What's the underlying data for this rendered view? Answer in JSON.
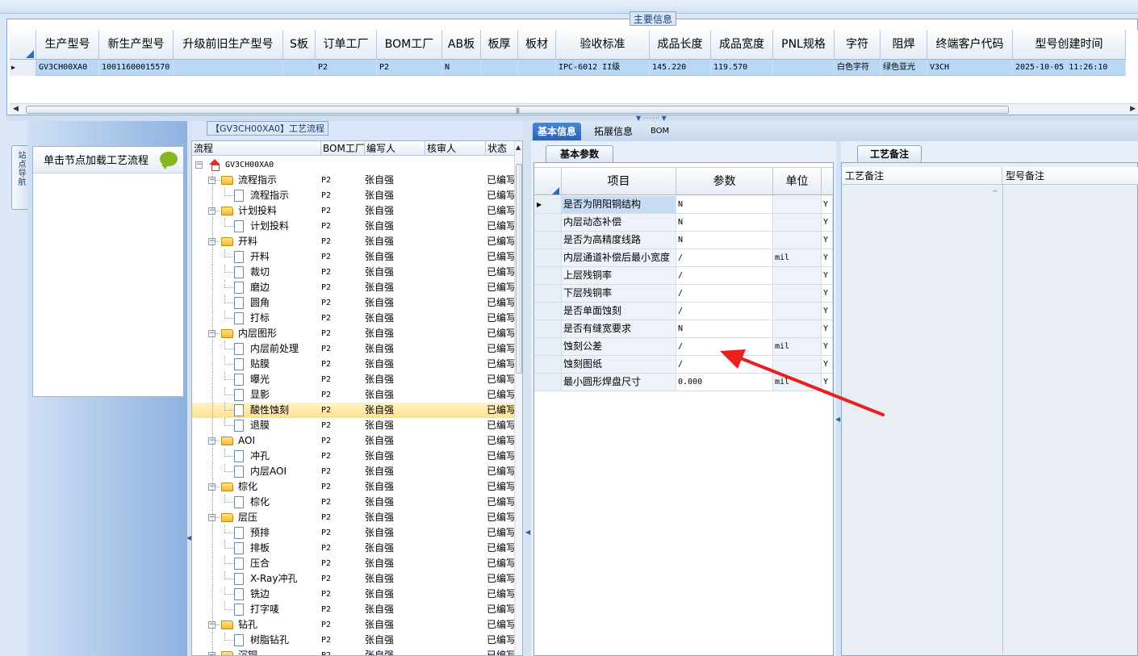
{
  "main_info": {
    "legend": "主要信息",
    "columns": [
      {
        "label": "生产型号",
        "w": 78
      },
      {
        "label": "新生产型号",
        "w": 92
      },
      {
        "label": "升级前旧生产型号",
        "w": 136
      },
      {
        "label": "S板",
        "w": 40
      },
      {
        "label": "订单工厂",
        "w": 76
      },
      {
        "label": "BOM工厂",
        "w": 81
      },
      {
        "label": "AB板",
        "w": 48
      },
      {
        "label": "板厚",
        "w": 46
      },
      {
        "label": "板材",
        "w": 47
      },
      {
        "label": "验收标准",
        "w": 116
      },
      {
        "label": "成品长度",
        "w": 76
      },
      {
        "label": "成品宽度",
        "w": 77
      },
      {
        "label": "PNL规格",
        "w": 76
      },
      {
        "label": "字符",
        "w": 57
      },
      {
        "label": "阻焊",
        "w": 58
      },
      {
        "label": "终端客户代码",
        "w": 106
      },
      {
        "label": "型号创建时间",
        "w": 140
      }
    ],
    "row": [
      "GV3CH00XA0",
      "10011600015570",
      "",
      "",
      "P2",
      "P2",
      "N",
      "",
      "",
      "IPC-6012 II级",
      "145.220",
      "119.570",
      "",
      "白色字符",
      "绿色亚光",
      "V3CH",
      "2025-10-05 11:26:10"
    ]
  },
  "left_nav": {
    "vertical_tab": "站点导航",
    "hint": "单击节点加载工艺流程"
  },
  "process_tree": {
    "legend": "【GV3CH00XA0】工艺流程",
    "headers": [
      "流程",
      "BOM工厂",
      "编写人",
      "核审人",
      "状态"
    ],
    "rows": [
      {
        "label": "GV3CH00XA0",
        "level": 0,
        "type": "root",
        "bom": "",
        "writer": "",
        "status": ""
      },
      {
        "label": "流程指示",
        "level": 1,
        "type": "folder",
        "bom": "P2",
        "writer": "张自强",
        "status": "已编写"
      },
      {
        "label": "流程指示",
        "level": 2,
        "type": "doc",
        "bom": "P2",
        "writer": "张自强",
        "status": "已编写"
      },
      {
        "label": "计划投料",
        "level": 1,
        "type": "folder",
        "bom": "P2",
        "writer": "张自强",
        "status": "已编写"
      },
      {
        "label": "计划投料",
        "level": 2,
        "type": "doc",
        "bom": "P2",
        "writer": "张自强",
        "status": "已编写"
      },
      {
        "label": "开料",
        "level": 1,
        "type": "folder",
        "bom": "P2",
        "writer": "张自强",
        "status": "已编写"
      },
      {
        "label": "开料",
        "level": 2,
        "type": "doc",
        "bom": "P2",
        "writer": "张自强",
        "status": "已编写"
      },
      {
        "label": "裁切",
        "level": 2,
        "type": "doc",
        "bom": "P2",
        "writer": "张自强",
        "status": "已编写"
      },
      {
        "label": "磨边",
        "level": 2,
        "type": "doc",
        "bom": "P2",
        "writer": "张自强",
        "status": "已编写"
      },
      {
        "label": "圆角",
        "level": 2,
        "type": "doc",
        "bom": "P2",
        "writer": "张自强",
        "status": "已编写"
      },
      {
        "label": "打标",
        "level": 2,
        "type": "doc",
        "bom": "P2",
        "writer": "张自强",
        "status": "已编写"
      },
      {
        "label": "内层图形",
        "level": 1,
        "type": "folder",
        "bom": "P2",
        "writer": "张自强",
        "status": "已编写"
      },
      {
        "label": "内层前处理",
        "level": 2,
        "type": "doc",
        "bom": "P2",
        "writer": "张自强",
        "status": "已编写"
      },
      {
        "label": "贴膜",
        "level": 2,
        "type": "doc",
        "bom": "P2",
        "writer": "张自强",
        "status": "已编写"
      },
      {
        "label": "曝光",
        "level": 2,
        "type": "doc",
        "bom": "P2",
        "writer": "张自强",
        "status": "已编写"
      },
      {
        "label": "显影",
        "level": 2,
        "type": "doc",
        "bom": "P2",
        "writer": "张自强",
        "status": "已编写"
      },
      {
        "label": "酸性蚀刻",
        "level": 2,
        "type": "doc",
        "bom": "P2",
        "writer": "张自强",
        "status": "已编写",
        "selected": true
      },
      {
        "label": "退膜",
        "level": 2,
        "type": "doc",
        "bom": "P2",
        "writer": "张自强",
        "status": "已编写"
      },
      {
        "label": "AOI",
        "level": 1,
        "type": "folder",
        "bom": "P2",
        "writer": "张自强",
        "status": "已编写"
      },
      {
        "label": "冲孔",
        "level": 2,
        "type": "doc",
        "bom": "P2",
        "writer": "张自强",
        "status": "已编写"
      },
      {
        "label": "内层AOI",
        "level": 2,
        "type": "doc",
        "bom": "P2",
        "writer": "张自强",
        "status": "已编写"
      },
      {
        "label": "棕化",
        "level": 1,
        "type": "folder",
        "bom": "P2",
        "writer": "张自强",
        "status": "已编写"
      },
      {
        "label": "棕化",
        "level": 2,
        "type": "doc",
        "bom": "P2",
        "writer": "张自强",
        "status": "已编写"
      },
      {
        "label": "层压",
        "level": 1,
        "type": "folder",
        "bom": "P2",
        "writer": "张自强",
        "status": "已编写"
      },
      {
        "label": "预排",
        "level": 2,
        "type": "doc",
        "bom": "P2",
        "writer": "张自强",
        "status": "已编写"
      },
      {
        "label": "排板",
        "level": 2,
        "type": "doc",
        "bom": "P2",
        "writer": "张自强",
        "status": "已编写"
      },
      {
        "label": "压合",
        "level": 2,
        "type": "doc",
        "bom": "P2",
        "writer": "张自强",
        "status": "已编写"
      },
      {
        "label": "X-Ray冲孔",
        "level": 2,
        "type": "doc",
        "bom": "P2",
        "writer": "张自强",
        "status": "已编写"
      },
      {
        "label": "铣边",
        "level": 2,
        "type": "doc",
        "bom": "P2",
        "writer": "张自强",
        "status": "已编写"
      },
      {
        "label": "打字唛",
        "level": 2,
        "type": "doc",
        "bom": "P2",
        "writer": "张自强",
        "status": "已编写"
      },
      {
        "label": "钻孔",
        "level": 1,
        "type": "folder",
        "bom": "P2",
        "writer": "张自强",
        "status": "已编写"
      },
      {
        "label": "树脂钻孔",
        "level": 2,
        "type": "doc",
        "bom": "P2",
        "writer": "张自强",
        "status": "已编写"
      },
      {
        "label": "沉铜",
        "level": 1,
        "type": "folder",
        "bom": "P2",
        "writer": "张自强",
        "status": "已编写"
      }
    ]
  },
  "right_tabs": [
    "基本信息",
    "拓展信息",
    "BOM"
  ],
  "basic_params": {
    "tab": "基本参数",
    "headers": [
      "项目",
      "参数",
      "单位"
    ],
    "rows": [
      {
        "item": "是否为阴阳铜结构",
        "value": "N",
        "unit": "",
        "flag": "Y"
      },
      {
        "item": "内层动态补偿",
        "value": "N",
        "unit": "",
        "flag": "Y"
      },
      {
        "item": "是否为高精度线路",
        "value": "N",
        "unit": "",
        "flag": "Y"
      },
      {
        "item": "内层通道补偿后最小宽度",
        "value": "/",
        "unit": "mil",
        "flag": "Y"
      },
      {
        "item": "上层残铜率",
        "value": "/",
        "unit": "",
        "flag": "Y"
      },
      {
        "item": "下层残铜率",
        "value": "/",
        "unit": "",
        "flag": "Y"
      },
      {
        "item": "是否单面蚀刻",
        "value": "/",
        "unit": "",
        "flag": "Y"
      },
      {
        "item": "是否有缝宽要求",
        "value": "N",
        "unit": "",
        "flag": "Y"
      },
      {
        "item": "蚀刻公差",
        "value": "/",
        "unit": "mil",
        "flag": "Y"
      },
      {
        "item": "蚀刻图纸",
        "value": "/",
        "unit": "",
        "flag": "Y"
      },
      {
        "item": "最小圆形焊盘尺寸",
        "value": "0.000",
        "unit": "mil",
        "flag": "Y"
      }
    ]
  },
  "craft_notes": {
    "tab": "工艺备注",
    "headers": [
      "工艺备注",
      "型号备注"
    ]
  },
  "colors": {
    "selection": "#b9d8f6",
    "annotation_arrow": "#e8201f",
    "tab_active": "#2a62b6"
  }
}
